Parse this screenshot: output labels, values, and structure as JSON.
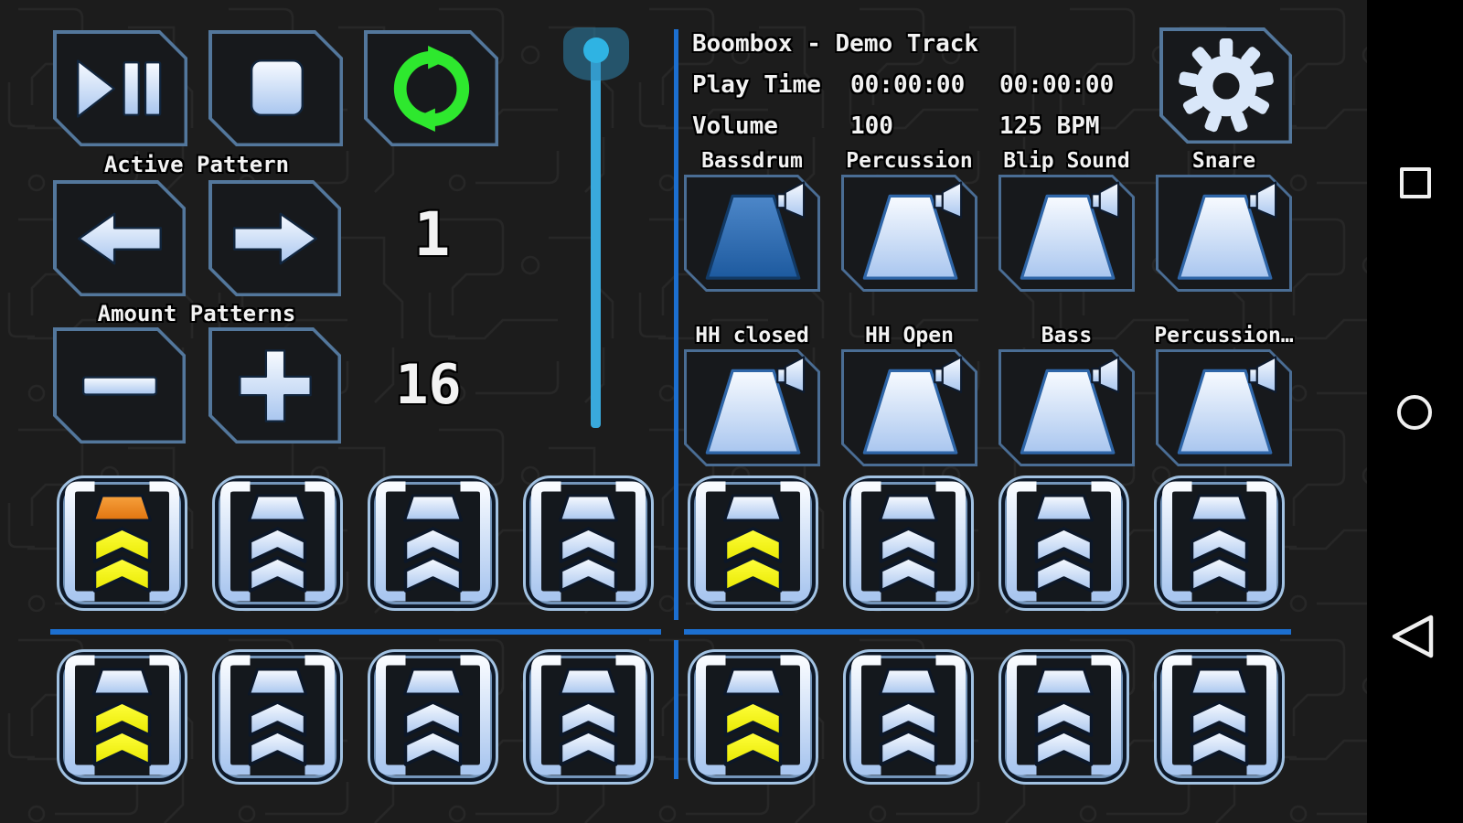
{
  "header": {
    "title": "Boombox - Demo Track",
    "play_time_label": "Play Time",
    "time_elapsed": "00:00:00",
    "time_total": "00:00:00",
    "volume_label": "Volume",
    "volume_value": "100",
    "bpm": "125 BPM"
  },
  "transport": {
    "play_pause_icon": "play-pause-icon",
    "stop_icon": "stop-icon",
    "loop_icon": "loop-icon"
  },
  "pattern_controls": {
    "active_pattern_label": "Active Pattern",
    "active_pattern_value": "1",
    "prev_icon": "arrow-left-icon",
    "next_icon": "arrow-right-icon",
    "amount_patterns_label": "Amount Patterns",
    "amount_patterns_value": "16",
    "decrease_icon": "minus-icon",
    "increase_icon": "plus-icon"
  },
  "volume_slider": {
    "orientation": "vertical",
    "thumb_position": "top",
    "value": "100"
  },
  "settings_icon": "gear-icon",
  "pads": [
    {
      "label": "Bassdrum",
      "active": true
    },
    {
      "label": "Percussion",
      "active": false
    },
    {
      "label": "Blip Sound",
      "active": false
    },
    {
      "label": "Snare",
      "active": false
    },
    {
      "label": "HH closed",
      "active": false
    },
    {
      "label": "HH Open",
      "active": false
    },
    {
      "label": "Bass",
      "active": false
    },
    {
      "label": "Percussion…",
      "active": false
    }
  ],
  "sequencer": {
    "steps": [
      {
        "on": true,
        "playhead": true
      },
      {
        "on": false,
        "playhead": false
      },
      {
        "on": false,
        "playhead": false
      },
      {
        "on": false,
        "playhead": false
      },
      {
        "on": true,
        "playhead": false
      },
      {
        "on": false,
        "playhead": false
      },
      {
        "on": false,
        "playhead": false
      },
      {
        "on": false,
        "playhead": false
      },
      {
        "on": true,
        "playhead": false
      },
      {
        "on": false,
        "playhead": false
      },
      {
        "on": false,
        "playhead": false
      },
      {
        "on": false,
        "playhead": false
      },
      {
        "on": true,
        "playhead": false
      },
      {
        "on": false,
        "playhead": false
      },
      {
        "on": false,
        "playhead": false
      },
      {
        "on": false,
        "playhead": false
      }
    ]
  },
  "navbar": {
    "recents_icon": "recents-square-icon",
    "home_icon": "home-circle-icon",
    "back_icon": "back-triangle-icon"
  },
  "colors": {
    "background": "#1c1c1c",
    "divider_blue": "#1c6fd0",
    "button_border": "#53779c",
    "icon_ice_top": "#f8fbff",
    "icon_ice_bottom": "#a9c6ef",
    "pad_active_top": "#4d87c9",
    "pad_active_bottom": "#1d5a9f",
    "loop_green": "#2ee82e",
    "playhead_orange": "#ef8418",
    "step_on_yellow": "#f5f500",
    "slider_blue": "#39a9dc",
    "nav_icon_white": "#f0f0f0"
  }
}
